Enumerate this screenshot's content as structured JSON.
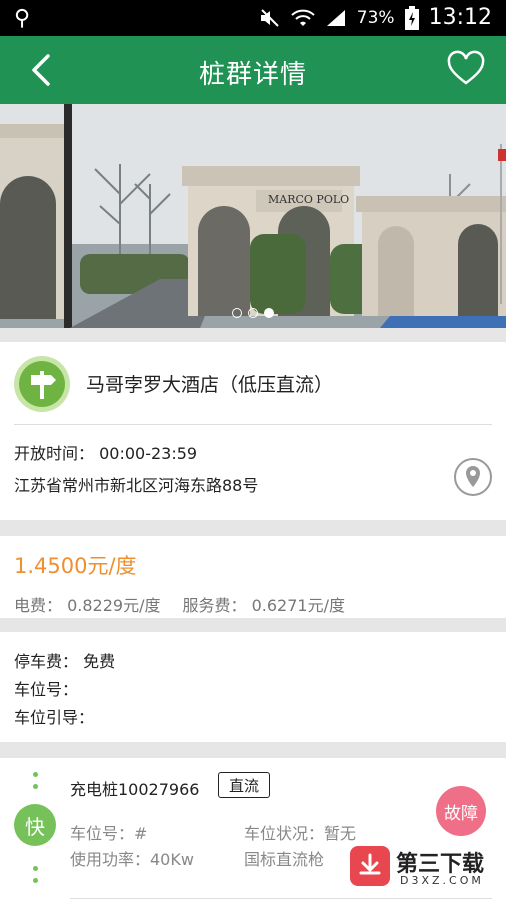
{
  "status_bar": {
    "battery": "73%",
    "time": "13:12"
  },
  "header": {
    "title": "桩群详情"
  },
  "banner": {
    "sign_text": "MARCO POLO",
    "dots": 3,
    "active_dot": 3
  },
  "station": {
    "name": "马哥孛罗大酒店（低压直流）",
    "open_label": "开放时间：",
    "open_hours": "00:00-23:59",
    "address": "江苏省常州市新北区河海东路88号"
  },
  "pricing": {
    "price": "1.4500元/度",
    "electric_label": "电费：",
    "electric_value": "0.8229元/度",
    "service_label": "服务费：",
    "service_value": "0.6271元/度"
  },
  "parking": {
    "fee_label": "停车费：",
    "fee_value": "免费",
    "spot_label": "车位号：",
    "guide_label": "车位引导："
  },
  "pile": {
    "title": "充电桩10027966",
    "type_tag": "直流",
    "speed_badge": "快",
    "spot_label": "车位号：#",
    "status_label": "车位状况：暂无",
    "power_label": "使用功率：40Kw",
    "gun_label": "国标直流枪"
  },
  "fault_button": "故障",
  "watermark": {
    "cn": "第三下载",
    "en": "D3XZ.COM"
  }
}
